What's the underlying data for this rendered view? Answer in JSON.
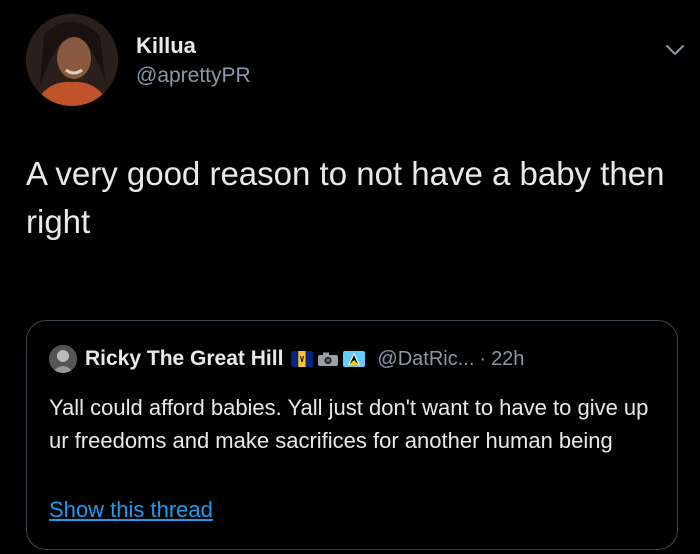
{
  "tweet": {
    "author": {
      "display_name": "Killua",
      "handle": "@aprettyPR",
      "avatar_icon": "user-avatar"
    },
    "more_icon": "chevron-down-icon",
    "text": "A very good reason to not have a baby then right"
  },
  "quoted_tweet": {
    "author": {
      "display_name": "Ricky The Great Hill",
      "handle": "@DatRic...",
      "avatar_icon": "user-avatar",
      "emoji_icons": [
        "barbados-flag-icon",
        "camera-icon",
        "saint-lucia-flag-icon"
      ]
    },
    "separator": "·",
    "time": "22h",
    "text": "Yall could afford babies. Yall just don't want to have to give up ur freedoms and make sacrifices for another human being",
    "show_thread_label": "Show this thread"
  },
  "colors": {
    "background": "#000000",
    "primary_text": "#e7e9ea",
    "secondary_text": "#8b98a5",
    "link": "#1d9bf0",
    "card_border": "#38444d"
  }
}
